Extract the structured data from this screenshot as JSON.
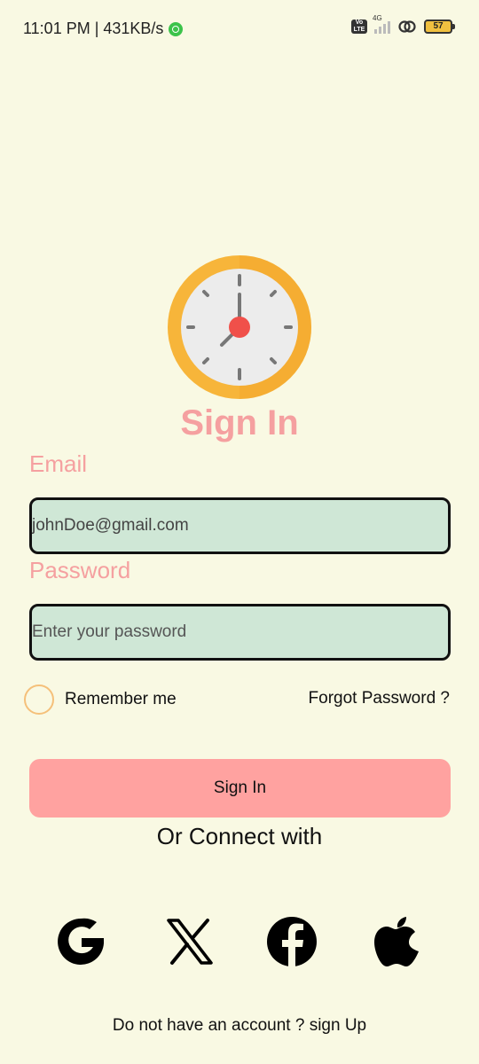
{
  "status_bar": {
    "time_speed": "11:01 PM | 431KB/s",
    "network_label": "4G",
    "volte_label": "Vo LTE",
    "battery_level": "57"
  },
  "title": "Sign In",
  "email": {
    "label": "Email",
    "value": "johnDoe@gmail.com"
  },
  "password": {
    "label": "Password",
    "placeholder": "Enter your password"
  },
  "remember_label": "Remember me",
  "forgot_label": "Forgot Password ?",
  "signin_button": "Sign In",
  "connect_label": "Or Connect with",
  "social": [
    "google-icon",
    "x-icon",
    "facebook-icon",
    "apple-icon"
  ],
  "signup_prompt": "Do not have an account ? sign Up",
  "colors": {
    "background": "#f9f9e3",
    "accent_pink": "#f5a0a0",
    "button": "#ffa2a0",
    "input_bg": "#cfe7d6",
    "clock_ring": "#f7b53a",
    "clock_center": "#f0504a"
  }
}
